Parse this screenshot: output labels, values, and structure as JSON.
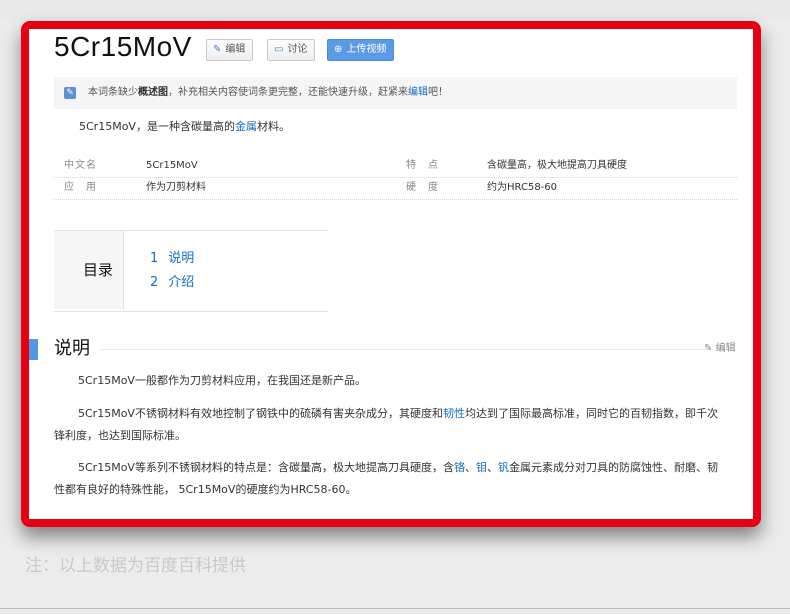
{
  "page_title": "5Cr15MoV",
  "actions": {
    "edit": "编辑",
    "discuss": "讨论",
    "upload_video": "上传视频"
  },
  "notice": {
    "prefix": "本词条缺少",
    "bold": "概述图",
    "middle": "，补充相关内容使词条更完整，还能快速升级，赶紧来",
    "link": "编辑",
    "suffix": "吧！"
  },
  "summary": {
    "before": "5Cr15MoV，是一种含碳量高的",
    "link": "金属",
    "after": "材料。"
  },
  "basic_info": [
    {
      "label": "中文名",
      "value": "5Cr15MoV"
    },
    {
      "label": "特　点",
      "value": "含碳量高，极大地提高刀具硬度"
    },
    {
      "label": "应　用",
      "value": "作为刀剪材料"
    },
    {
      "label": "硬　度",
      "value": "约为HRC58-60"
    }
  ],
  "toc": {
    "heading": "目录",
    "items": [
      {
        "num": "1",
        "label": "说明"
      },
      {
        "num": "2",
        "label": "介绍"
      }
    ]
  },
  "section": {
    "title": "说明",
    "edit": "编辑",
    "p1": "5Cr15MoV一般都作为刀剪材料应用，在我国还是新产品。",
    "p2_before": "5Cr15MoV不锈钢材料有效地控制了钢铁中的硫磷有害夹杂成分，其硬度和",
    "p2_link": "韧性",
    "p2_after": "均达到了国际最高标准，同时它的百韧指数，即千次锋利度，也达到国际标准。",
    "p3_a": "5Cr15MoV等系列不锈钢材料的特点是：含碳量高，极大地提高刀具硬度，含",
    "p3_link1": "铬",
    "p3_sep1": "、",
    "p3_link2": "钼",
    "p3_sep2": "、",
    "p3_link3": "钒",
    "p3_b": "金属元素成分对刀具的防腐蚀性、耐磨、韧性都有良好的特殊性能， 5Cr15MoV的硬度约为HRC58-60。"
  },
  "footer_note": "注：以上数据为百度百科提供",
  "colors": {
    "frame": "#e60012",
    "link": "#136ec2",
    "accent": "#4f9ae8",
    "video_button": "#5b9be6"
  },
  "icons": {
    "edit": "pencil-icon",
    "discuss": "chat-icon",
    "upload_video": "plus-circle-icon",
    "notice": "pencil-note-icon"
  }
}
